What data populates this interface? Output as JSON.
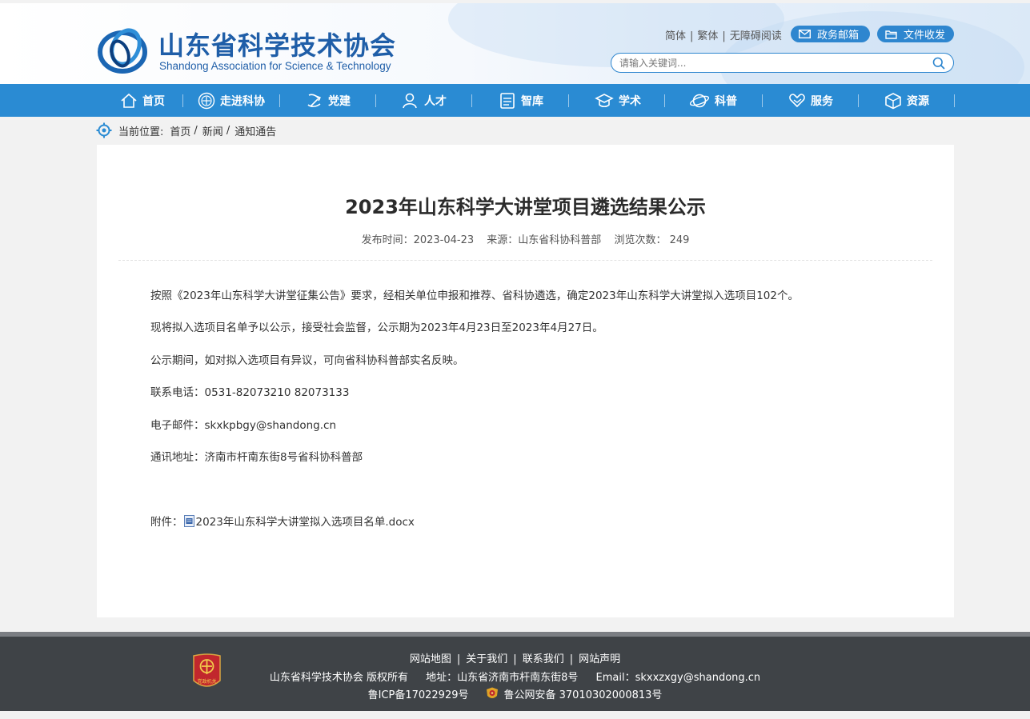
{
  "header": {
    "logo_cn": "山东省科学技术协会",
    "logo_en": "Shandong Association for Science & Technology",
    "links": [
      "简体",
      "繁体",
      "无障碍阅读"
    ],
    "buttons": {
      "mail": "政务邮箱",
      "files": "文件收发"
    },
    "search_placeholder": "请输入关键词..."
  },
  "nav": {
    "items": [
      {
        "label": "首页",
        "icon": "home-icon"
      },
      {
        "label": "走进科协",
        "icon": "emblem-icon"
      },
      {
        "label": "党建",
        "icon": "party-icon"
      },
      {
        "label": "人才",
        "icon": "person-icon"
      },
      {
        "label": "智库",
        "icon": "document-icon"
      },
      {
        "label": "学术",
        "icon": "graduation-cap-icon"
      },
      {
        "label": "科普",
        "icon": "planet-icon"
      },
      {
        "label": "服务",
        "icon": "heart-hand-icon"
      },
      {
        "label": "资源",
        "icon": "box-icon"
      }
    ]
  },
  "breadcrumb": {
    "prefix": "当前位置:",
    "items": [
      "首页",
      "新闻",
      "通知通告"
    ]
  },
  "article": {
    "title": "2023年山东科学大讲堂项目遴选结果公示",
    "meta": {
      "date": "发布时间：2023-04-23",
      "source": "来源：山东省科协科普部",
      "views": "浏览次数：  249"
    },
    "paragraphs": [
      "按照《2023年山东科学大讲堂征集公告》要求，经相关单位申报和推荐、省科协遴选，确定2023年山东科学大讲堂拟入选项目102个。",
      "现将拟入选项目名单予以公示，接受社会监督，公示期为2023年4月23日至2023年4月27日。",
      "公示期间，如对拟入选项目有异议，可向省科协科普部实名反映。",
      "联系电话：0531-82073210  82073133",
      "电子邮件：skxkpbgy@shandong.cn",
      "通讯地址：济南市杆南东街8号省科协科普部"
    ],
    "attachment_label": "附件：",
    "attachment_file": "2023年山东科学大讲堂拟入选项目名单.docx"
  },
  "footer": {
    "links": [
      "网站地图",
      "关于我们",
      "联系我们",
      "网站声明"
    ],
    "badge_text": "党政机关",
    "copyright": "山东省科学技术协会 版权所有",
    "address": "地址：山东省济南市杆南东街8号",
    "email": "Email：skxxzxgy@shandong.cn",
    "icp": "鲁ICP备17022929号",
    "police": "鲁公网安备 37010302000813号"
  },
  "colors": {
    "primary_blue": "#2a8bd3",
    "footer_bg": "#3f4347",
    "badge_red": "#c1272d"
  }
}
